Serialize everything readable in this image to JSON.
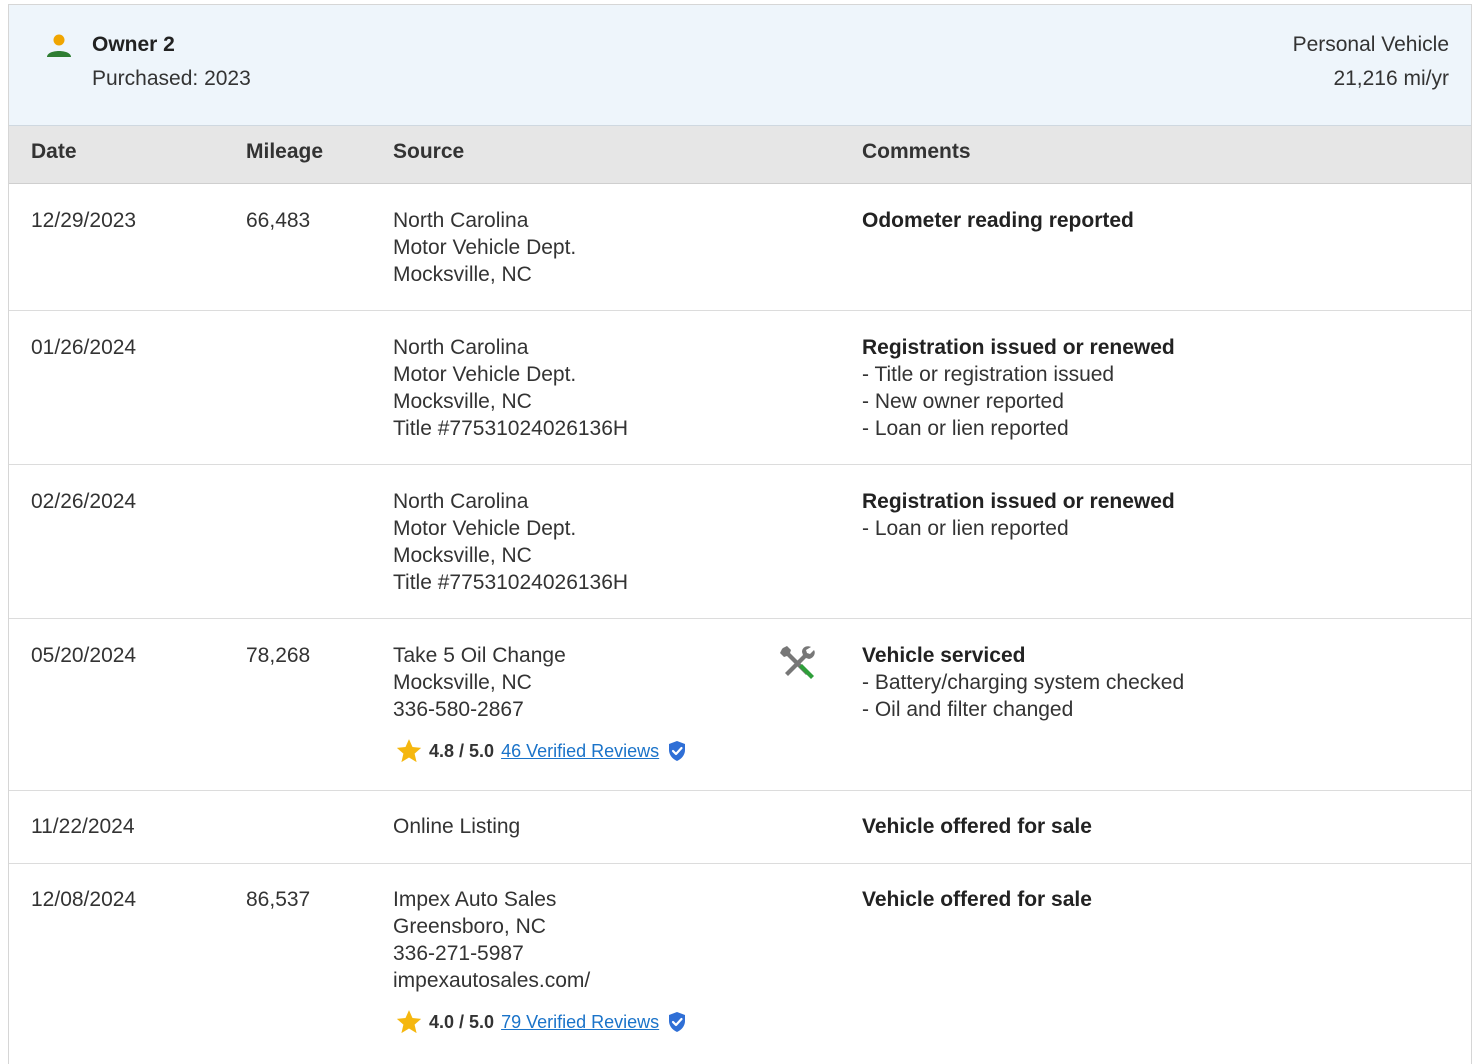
{
  "owner": {
    "name": "Owner 2",
    "purchased": "Purchased: 2023",
    "vehicle_type": "Personal Vehicle",
    "miles_per_year": "21,216 mi/yr",
    "icon": "person-icon"
  },
  "columns": {
    "date": "Date",
    "mileage": "Mileage",
    "source": "Source",
    "comments": "Comments"
  },
  "colors": {
    "header_bg": "#eef5fb",
    "table_header_bg": "#e6e6e6",
    "link": "#1a73c9",
    "star": "#f5b70f",
    "person_head": "#f0a500",
    "person_body": "#2e7d32",
    "wrench_green": "#2e9e3a"
  },
  "records": [
    {
      "date": "12/29/2023",
      "mileage": "66,483",
      "source": [
        "North Carolina",
        "Motor Vehicle Dept.",
        "Mocksville, NC"
      ],
      "comment_title": "Odometer reading reported",
      "comment_items": []
    },
    {
      "date": "01/26/2024",
      "mileage": "",
      "source": [
        "North Carolina",
        "Motor Vehicle Dept.",
        "Mocksville, NC",
        "Title #77531024026136H"
      ],
      "comment_title": "Registration issued or renewed",
      "comment_items": [
        "- Title or registration issued",
        "- New owner reported",
        "- Loan or lien reported"
      ]
    },
    {
      "date": "02/26/2024",
      "mileage": "",
      "source": [
        "North Carolina",
        "Motor Vehicle Dept.",
        "Mocksville, NC",
        "Title #77531024026136H"
      ],
      "comment_title": "Registration issued or renewed",
      "comment_items": [
        "- Loan or lien reported"
      ]
    },
    {
      "date": "05/20/2024",
      "mileage": "78,268",
      "source": [
        "Take 5 Oil Change",
        "Mocksville, NC",
        "336-580-2867"
      ],
      "rating": "4.8 / 5.0",
      "reviews": "46 Verified Reviews",
      "icon": "service-tools-icon",
      "comment_title": "Vehicle serviced",
      "comment_items": [
        "- Battery/charging system checked",
        "- Oil and filter changed"
      ]
    },
    {
      "date": "11/22/2024",
      "mileage": "",
      "source": [
        "Online Listing"
      ],
      "comment_title": "Vehicle offered for sale",
      "comment_items": []
    },
    {
      "date": "12/08/2024",
      "mileage": "86,537",
      "source": [
        "Impex Auto Sales",
        "Greensboro, NC",
        "336-271-5987",
        "impexautosales.com/"
      ],
      "rating": "4.0 / 5.0",
      "reviews": "79 Verified Reviews",
      "comment_title": "Vehicle offered for sale",
      "comment_items": []
    }
  ]
}
